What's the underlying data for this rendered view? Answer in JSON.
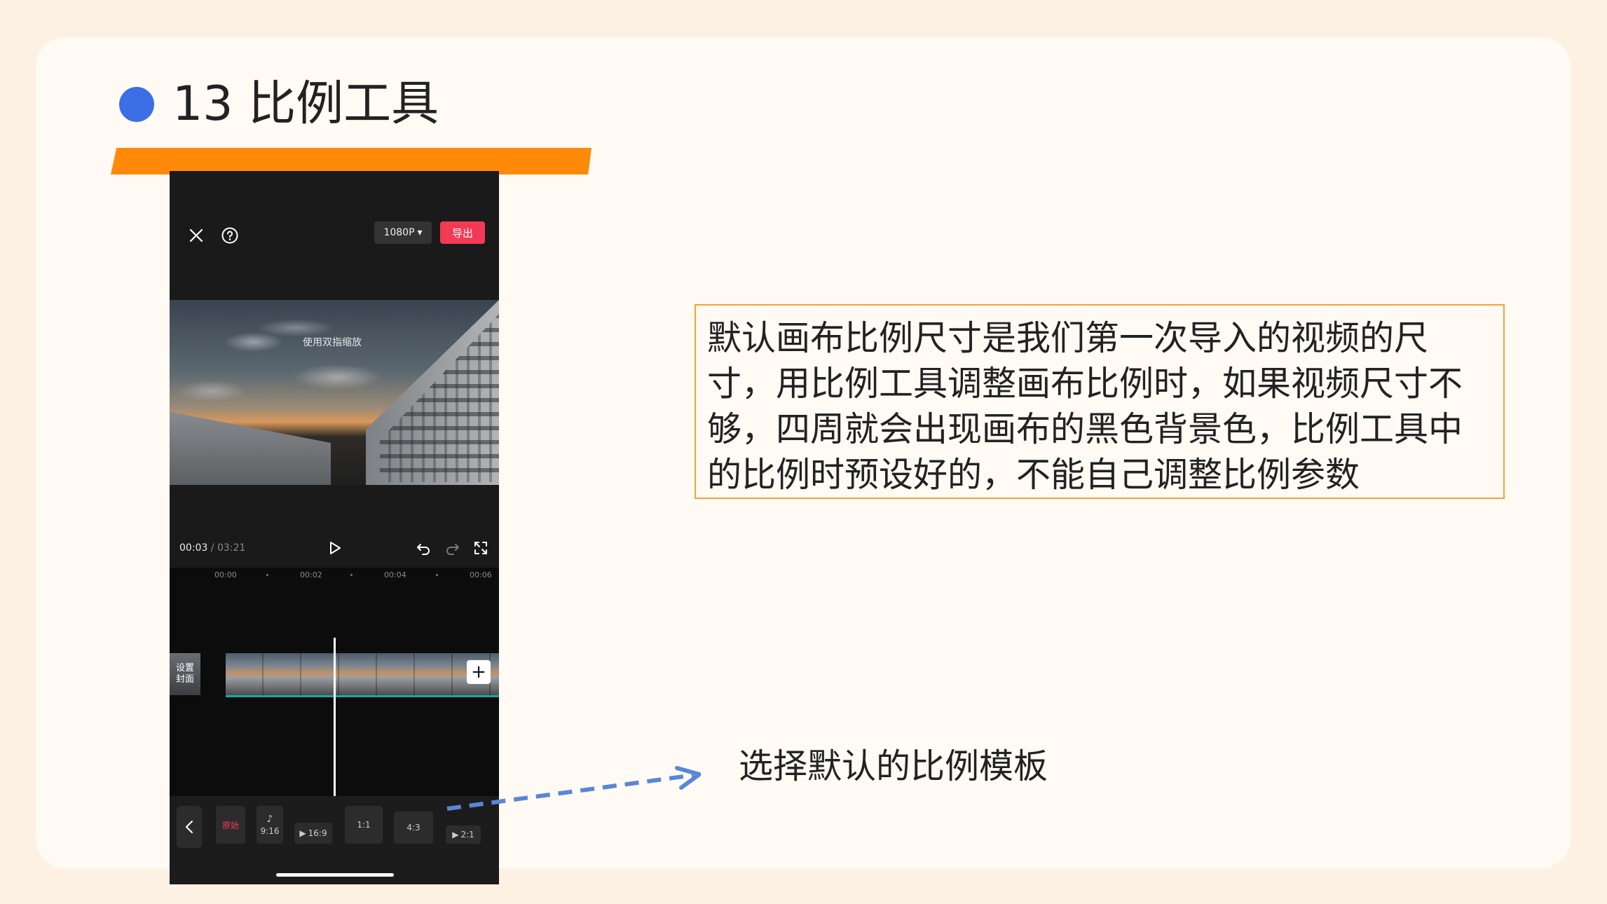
{
  "slide": {
    "title": "13 比例工具",
    "description": "默认画布比例尺寸是我们第一次导入的视频的尺寸，用比例工具调整画布比例时，如果视频尺寸不够，四周就会出现画布的黑色背景色，比例工具中的比例时预设好的，不能自己调整比例参数",
    "arrow_label": "选择默认的比例模板",
    "colors": {
      "accent_dot": "#3c6ee6",
      "accent_bar": "#ff8a0a",
      "box_border": "#f4a236",
      "export": "#f23a55"
    }
  },
  "editor": {
    "resolution": "1080P",
    "export_label": "导出",
    "preview_hint": "使用双指缩放",
    "time_current": "00:03",
    "time_sep": " / ",
    "time_total": "03:21",
    "ruler": [
      "00:00",
      "00:02",
      "00:04",
      "00:06"
    ],
    "cover_label_1": "设置",
    "cover_label_2": "封面",
    "add_clip": "+",
    "ratios": [
      {
        "label": "原始"
      },
      {
        "label": "9:16",
        "icon": "tiktok-icon"
      },
      {
        "label": "16:9",
        "icon": "youtube-icon"
      },
      {
        "label": "1:1"
      },
      {
        "label": "4:3"
      },
      {
        "label": "2:1",
        "icon": "youtube-icon"
      }
    ],
    "icons": [
      "close-icon",
      "help-icon",
      "chevron-down-icon",
      "play-icon",
      "undo-icon",
      "redo-icon",
      "fullscreen-icon",
      "chevron-left-icon"
    ]
  }
}
